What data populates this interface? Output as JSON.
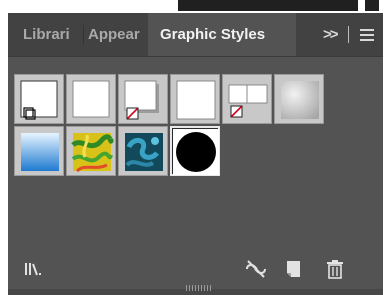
{
  "tabs": [
    {
      "label": "Librari",
      "active": false
    },
    {
      "label": "Appear",
      "active": false
    },
    {
      "label": "Graphic Styles",
      "active": true
    }
  ],
  "controls": {
    "collapse_label": ">>",
    "menu_icon": "hamburger-icon"
  },
  "graphic_styles": [
    {
      "name": "default",
      "kind": "default-style"
    },
    {
      "name": "white-fill",
      "kind": "plain"
    },
    {
      "name": "shadow-none",
      "kind": "shadow-with-none-swatch"
    },
    {
      "name": "white-shadow",
      "kind": "plain-shadow"
    },
    {
      "name": "double-box-none",
      "kind": "double-box-with-none-swatch"
    },
    {
      "name": "gray-radial",
      "kind": "gray-gradient"
    },
    {
      "name": "blue-gradient",
      "kind": "blue-gradient"
    },
    {
      "name": "yellow-green-swirl",
      "kind": "yellow-green-pattern"
    },
    {
      "name": "teal-swirl",
      "kind": "teal-pattern"
    },
    {
      "name": "black-circle",
      "kind": "black-circle",
      "selected": true
    }
  ],
  "bottom_icons": [
    "graphic-styles-libraries-icon",
    "break-link-icon",
    "new-graphic-style-icon",
    "delete-icon"
  ],
  "colors": {
    "panel_bg": "#535353",
    "tab_bar_bg": "#424242",
    "active_tab_text": "#f2f2f2",
    "inactive_tab_text": "#a9a9a9",
    "none_slash": "#d0021b"
  }
}
